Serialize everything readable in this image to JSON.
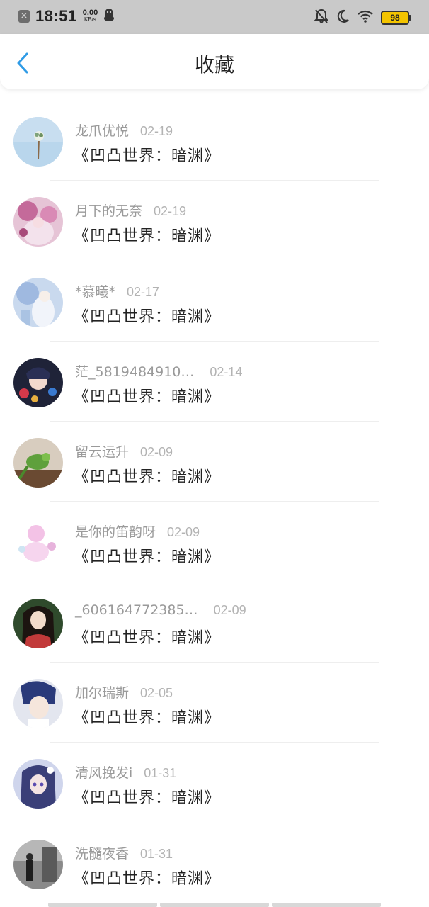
{
  "status_bar": {
    "time": "18:51",
    "net_speed_value": "0.00",
    "net_speed_unit": "KB/s",
    "battery": "98"
  },
  "header": {
    "title": "收藏",
    "back_icon": "chevron-left-icon"
  },
  "colors": {
    "back_arrow": "#2f9be6",
    "status_bar_bg": "#c9c9c9",
    "battery_fill": "#f3c400"
  },
  "favorites": [
    {
      "name": "龙爪优悦",
      "date": "02-19",
      "subject": "《凹凸世界：暗渊》"
    },
    {
      "name": "月下的无奈",
      "date": "02-19",
      "subject": "《凹凸世界：暗渊》"
    },
    {
      "name": "*慕曦*",
      "date": "02-17",
      "subject": "《凹凸世界：暗渊》"
    },
    {
      "name": "茫_5819484910…",
      "date": "02-14",
      "subject": "《凹凸世界：暗渊》"
    },
    {
      "name": "留云运升",
      "date": "02-09",
      "subject": "《凹凸世界：暗渊》"
    },
    {
      "name": "是你的笛韵呀",
      "date": "02-09",
      "subject": "《凹凸世界：暗渊》"
    },
    {
      "name": "_606164772385…",
      "date": "02-09",
      "subject": "《凹凸世界：暗渊》"
    },
    {
      "name": "加尔瑞斯",
      "date": "02-05",
      "subject": "《凹凸世界：暗渊》"
    },
    {
      "name": "清风挽发i",
      "date": "01-31",
      "subject": "《凹凸世界：暗渊》"
    },
    {
      "name": "洗髓夜香",
      "date": "01-31",
      "subject": "《凹凸世界：暗渊》"
    }
  ]
}
